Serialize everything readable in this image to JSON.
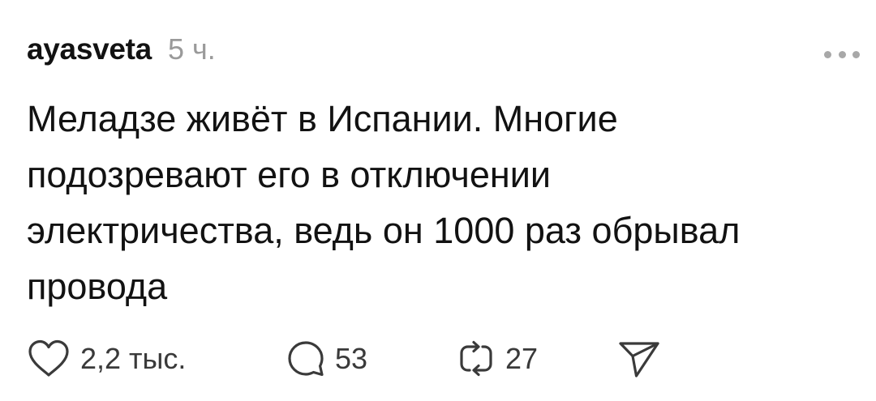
{
  "post": {
    "username": "ayasveta",
    "timestamp": "5 ч.",
    "text_lines": [
      "Меладзе живёт в Испании. Многие",
      "подозревают его в отключении",
      "электричества, ведь он 1000 раз обрывал",
      "провода"
    ],
    "actions": {
      "likes": "2,2 тыс.",
      "comments": "53",
      "reposts": "27"
    }
  },
  "icons": {
    "more": "more-horizontal-icon",
    "like": "heart-icon",
    "comment": "comment-bubble-icon",
    "repost": "repost-icon",
    "share": "send-icon"
  },
  "colors": {
    "text": "#121212",
    "secondary": "#9a9a9a",
    "icon": "#3a3a3a"
  }
}
